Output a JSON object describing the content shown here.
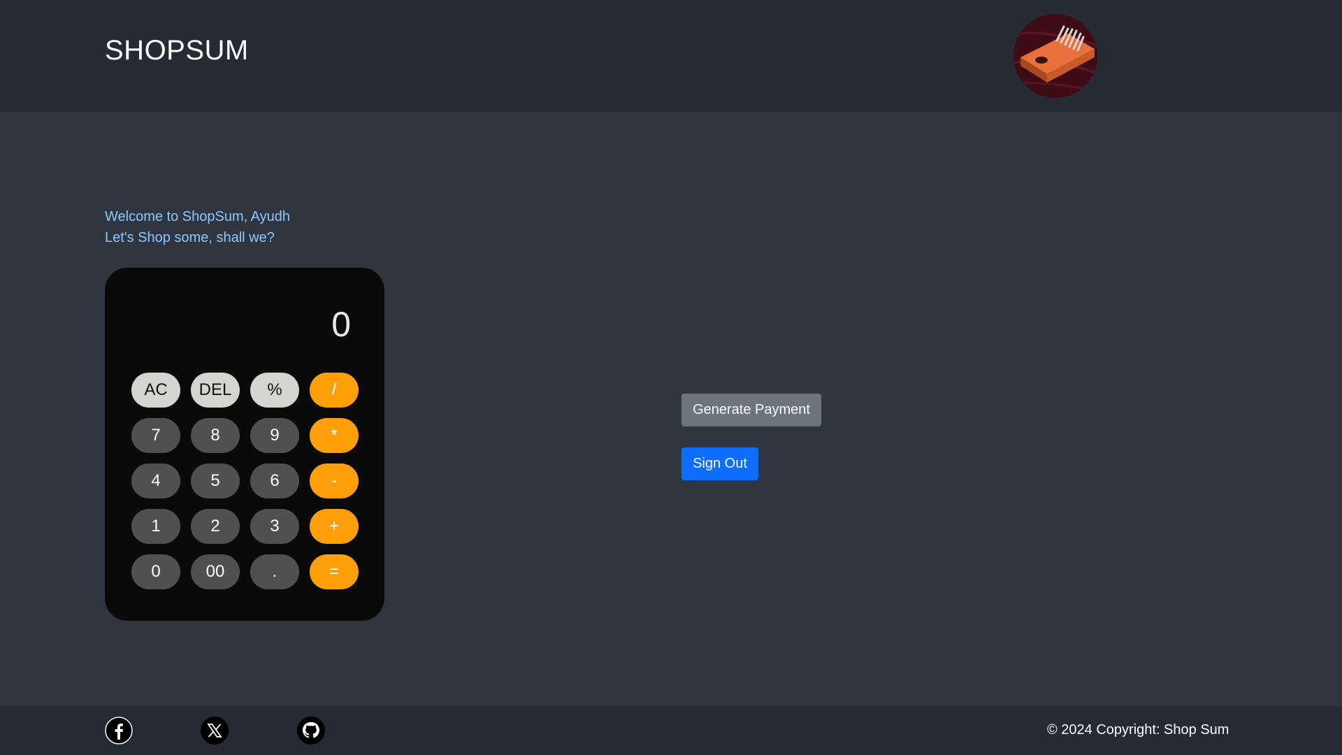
{
  "header": {
    "brand": "SHOPSUM",
    "avatar_icon": "kalimba-avatar-icon"
  },
  "welcome": {
    "line1": "Welcome to ShopSum, Ayudh",
    "line2": "Let's Shop some, shall we?"
  },
  "calculator": {
    "display": "0",
    "keys": [
      {
        "label": "AC",
        "kind": "fn"
      },
      {
        "label": "DEL",
        "kind": "fn"
      },
      {
        "label": "%",
        "kind": "fn"
      },
      {
        "label": "/",
        "kind": "op"
      },
      {
        "label": "7",
        "kind": "num"
      },
      {
        "label": "8",
        "kind": "num"
      },
      {
        "label": "9",
        "kind": "num"
      },
      {
        "label": "*",
        "kind": "op"
      },
      {
        "label": "4",
        "kind": "num"
      },
      {
        "label": "5",
        "kind": "num"
      },
      {
        "label": "6",
        "kind": "num"
      },
      {
        "label": "-",
        "kind": "op"
      },
      {
        "label": "1",
        "kind": "num"
      },
      {
        "label": "2",
        "kind": "num"
      },
      {
        "label": "3",
        "kind": "num"
      },
      {
        "label": "+",
        "kind": "op"
      },
      {
        "label": "0",
        "kind": "num"
      },
      {
        "label": "00",
        "kind": "num"
      },
      {
        "label": ".",
        "kind": "num"
      },
      {
        "label": "=",
        "kind": "op"
      }
    ]
  },
  "actions": {
    "generate_payment": "Generate Payment",
    "sign_out": "Sign Out"
  },
  "footer": {
    "social": [
      "facebook-icon",
      "x-twitter-icon",
      "github-icon"
    ],
    "copyright": "© 2024 Copyright: Shop Sum"
  },
  "colors": {
    "header_bg": "#262a33",
    "main_bg": "#30363f",
    "welcome_text": "#8fc6ff",
    "operator_key": "#ffa00a",
    "function_key": "#d4d4d2",
    "number_key": "#505050",
    "generate_button": "#6c757d",
    "signout_button": "#0d6efd"
  }
}
